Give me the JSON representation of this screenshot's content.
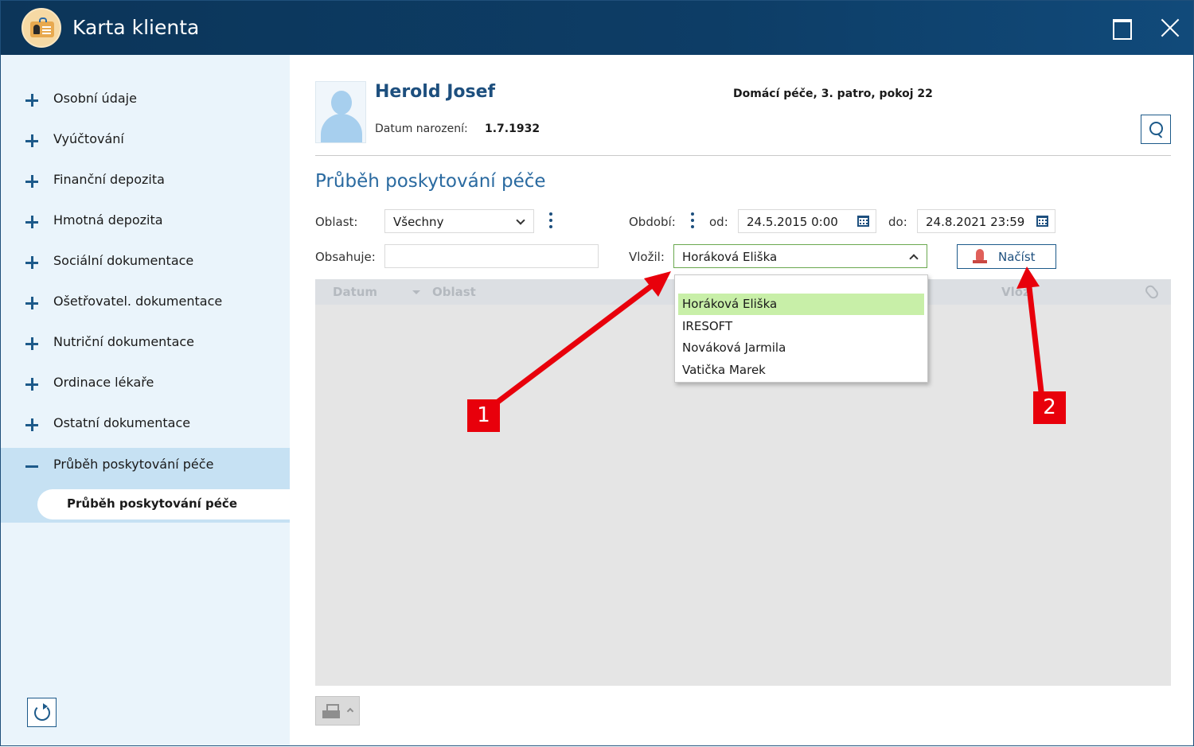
{
  "window": {
    "title": "Karta klienta"
  },
  "sidebar": {
    "items": [
      {
        "label": "Osobní údaje"
      },
      {
        "label": "Vyúčtování"
      },
      {
        "label": "Finanční depozita"
      },
      {
        "label": "Hmotná depozita"
      },
      {
        "label": "Sociální dokumentace"
      },
      {
        "label": "Ošetřovatel. dokumentace"
      },
      {
        "label": "Nutriční dokumentace"
      },
      {
        "label": "Ordinace lékaře"
      },
      {
        "label": "Ostatní dokumentace"
      },
      {
        "label": "Průběh poskytování péče"
      }
    ],
    "sub_item": "Průběh poskytování péče"
  },
  "client": {
    "name": "Herold Josef",
    "dob_label": "Datum narození:",
    "dob": "1.7.1932",
    "location": "Domácí péče, 3. patro, pokoj 22"
  },
  "section": {
    "title": "Průběh poskytování péče"
  },
  "filters": {
    "oblast_label": "Oblast:",
    "oblast_value": "Všechny",
    "obdobi_label": "Období:",
    "od_label": "od:",
    "od_value": "24.5.2015 0:00",
    "do_label": "do:",
    "do_value": "24.8.2021 23:59",
    "obsahuje_label": "Obsahuje:",
    "obsahuje_value": "",
    "vlozil_label": "Vložil:",
    "vlozil_value": "Horáková Eliška",
    "load_button": "Načíst"
  },
  "grid": {
    "columns": [
      "Datum",
      "Oblast",
      "Vlož"
    ]
  },
  "dropdown": {
    "options": [
      "",
      "Horáková Eliška",
      "IRESOFT",
      "Nováková Jarmila",
      "Vatička Marek"
    ],
    "selected": "Horáková Eliška"
  },
  "annotations": {
    "callout_1": "1",
    "callout_2": "2",
    "color": "#e8000b"
  },
  "icons": [
    "app-logo-icon",
    "maximize-icon",
    "close-icon",
    "plus-icon",
    "minus-icon",
    "search-icon",
    "calendar-icon",
    "bell-icon",
    "printer-icon",
    "refresh-icon",
    "paperclip-icon"
  ]
}
